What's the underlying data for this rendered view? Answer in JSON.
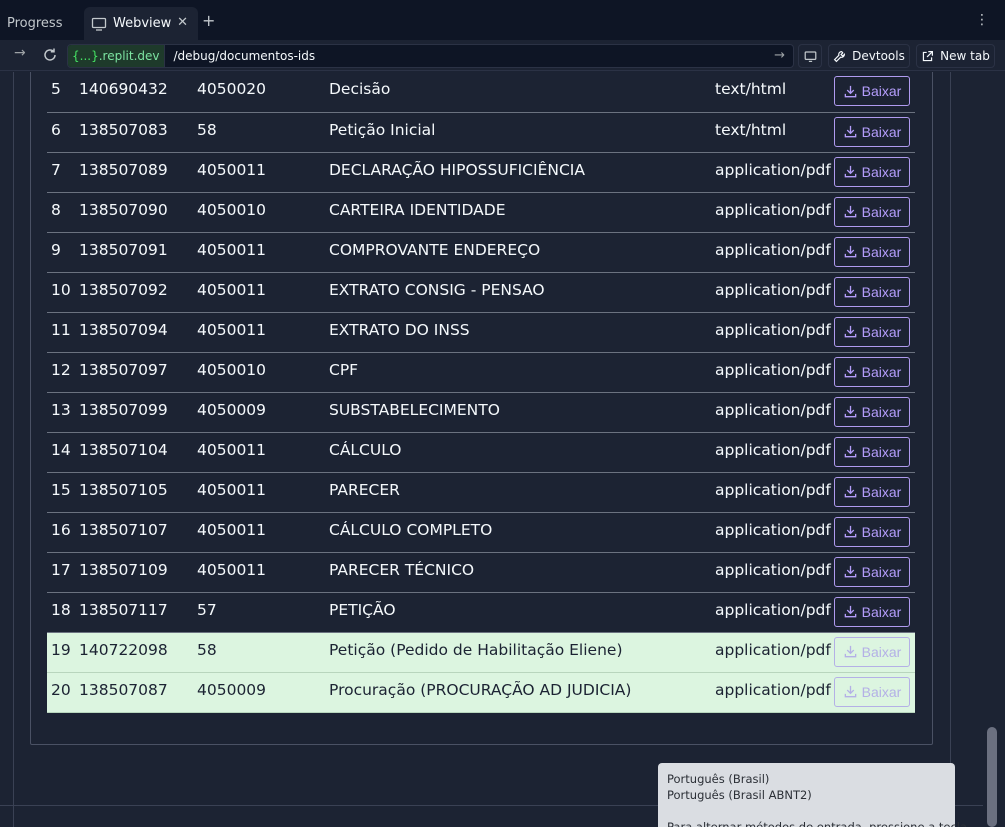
{
  "tabs": {
    "progress_label": "Progress",
    "webview_label": "Webview",
    "close_glyph": "✕",
    "new_tab_glyph": "+",
    "menu_glyph": "⋮"
  },
  "address": {
    "host_braces": "{...}",
    "host_domain": ".replit.dev",
    "path": "/debug/documentos-ids",
    "devtools_label": "Devtools",
    "newtab_label": "New tab"
  },
  "table": {
    "rows": [
      {
        "n": "5",
        "id": "140690432",
        "tipo": "4050020",
        "nome": "Decisão",
        "mime": "text/html",
        "action": "Baixar",
        "highlight": false
      },
      {
        "n": "6",
        "id": "138507083",
        "tipo": "58",
        "nome": "Petição Inicial",
        "mime": "text/html",
        "action": "Baixar",
        "highlight": false
      },
      {
        "n": "7",
        "id": "138507089",
        "tipo": "4050011",
        "nome": "DECLARAÇÃO HIPOSSUFICIÊNCIA",
        "mime": "application/pdf",
        "action": "Baixar",
        "highlight": false
      },
      {
        "n": "8",
        "id": "138507090",
        "tipo": "4050010",
        "nome": "CARTEIRA IDENTIDADE",
        "mime": "application/pdf",
        "action": "Baixar",
        "highlight": false
      },
      {
        "n": "9",
        "id": "138507091",
        "tipo": "4050011",
        "nome": "COMPROVANTE ENDEREÇO",
        "mime": "application/pdf",
        "action": "Baixar",
        "highlight": false
      },
      {
        "n": "10",
        "id": "138507092",
        "tipo": "4050011",
        "nome": "EXTRATO CONSIG - PENSAO",
        "mime": "application/pdf",
        "action": "Baixar",
        "highlight": false
      },
      {
        "n": "11",
        "id": "138507094",
        "tipo": "4050011",
        "nome": "EXTRATO DO INSS",
        "mime": "application/pdf",
        "action": "Baixar",
        "highlight": false
      },
      {
        "n": "12",
        "id": "138507097",
        "tipo": "4050010",
        "nome": "CPF",
        "mime": "application/pdf",
        "action": "Baixar",
        "highlight": false
      },
      {
        "n": "13",
        "id": "138507099",
        "tipo": "4050009",
        "nome": "SUBSTABELECIMENTO",
        "mime": "application/pdf",
        "action": "Baixar",
        "highlight": false
      },
      {
        "n": "14",
        "id": "138507104",
        "tipo": "4050011",
        "nome": "CÁLCULO",
        "mime": "application/pdf",
        "action": "Baixar",
        "highlight": false
      },
      {
        "n": "15",
        "id": "138507105",
        "tipo": "4050011",
        "nome": "PARECER",
        "mime": "application/pdf",
        "action": "Baixar",
        "highlight": false
      },
      {
        "n": "16",
        "id": "138507107",
        "tipo": "4050011",
        "nome": "CÁLCULO COMPLETO",
        "mime": "application/pdf",
        "action": "Baixar",
        "highlight": false
      },
      {
        "n": "17",
        "id": "138507109",
        "tipo": "4050011",
        "nome": "PARECER TÉCNICO",
        "mime": "application/pdf",
        "action": "Baixar",
        "highlight": false
      },
      {
        "n": "18",
        "id": "138507117",
        "tipo": "57",
        "nome": "PETIÇÃO",
        "mime": "application/pdf",
        "action": "Baixar",
        "highlight": false
      },
      {
        "n": "19",
        "id": "140722098",
        "tipo": "58",
        "nome": "Petição (Pedido de Habilitação Eliene)",
        "mime": "application/pdf",
        "action": "Baixar",
        "highlight": true
      },
      {
        "n": "20",
        "id": "138507087",
        "tipo": "4050009",
        "nome": "Procuração (PROCURAÇÃO AD JUDICIA)",
        "mime": "application/pdf",
        "action": "Baixar",
        "highlight": true
      }
    ]
  },
  "ime_popup": {
    "line1": "Português (Brasil)",
    "line2": "Português (Brasil ABNT2)",
    "hint": "Para alternar métodos de entrada, pressione a tecla"
  },
  "colors": {
    "background": "#1c2333",
    "tabbar": "#0e1525",
    "highlight_row": "#dcf5e0",
    "button_accent": "#b49dfb",
    "host_green": "#45e363"
  }
}
